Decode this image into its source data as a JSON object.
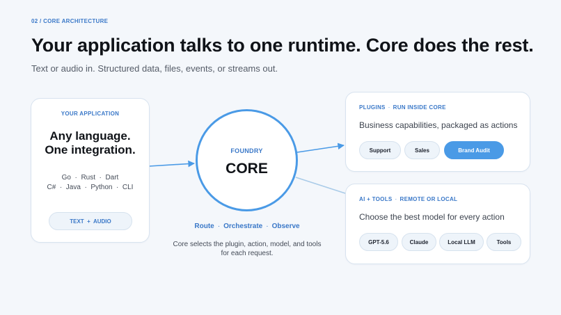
{
  "eyebrow": "02  /  CORE ARCHITECTURE",
  "title": "Your application talks to one runtime. Core does the rest.",
  "subtitle": "Text or audio in. Structured data, files, events, or streams out.",
  "app": {
    "heading": "YOUR APPLICATION",
    "headline_1": "Any language.",
    "headline_2": "One integration.",
    "langs_line_1": "Go  ·  Rust  ·  Dart",
    "langs_line_2": "C#  ·  Java  ·  Python  ·  CLI",
    "io_pill": "TEXT  +  AUDIO"
  },
  "core": {
    "label": "FOUNDRY",
    "name": "CORE",
    "verbs": [
      "Route",
      "Orchestrate",
      "Observe"
    ],
    "description": "Core selects the plugin, action, model, and tools for each request."
  },
  "plugins": {
    "heading_a": "PLUGINS",
    "heading_b": "RUN INSIDE CORE",
    "description": "Business capabilities, packaged as actions",
    "chips": [
      "Support",
      "Sales",
      "Brand Audit"
    ],
    "active_chip": "Brand Audit"
  },
  "ai": {
    "heading_a": "AI + TOOLS",
    "heading_b": "REMOTE OR LOCAL",
    "description": "Choose the best model for every action",
    "chips": [
      "GPT-5.6",
      "Claude",
      "Local LLM",
      "Tools"
    ]
  },
  "colors": {
    "accent": "#3a78c8",
    "core_ring": "#4a9ae6",
    "link_light": "#a9cbe8",
    "background": "#f4f7fb"
  }
}
